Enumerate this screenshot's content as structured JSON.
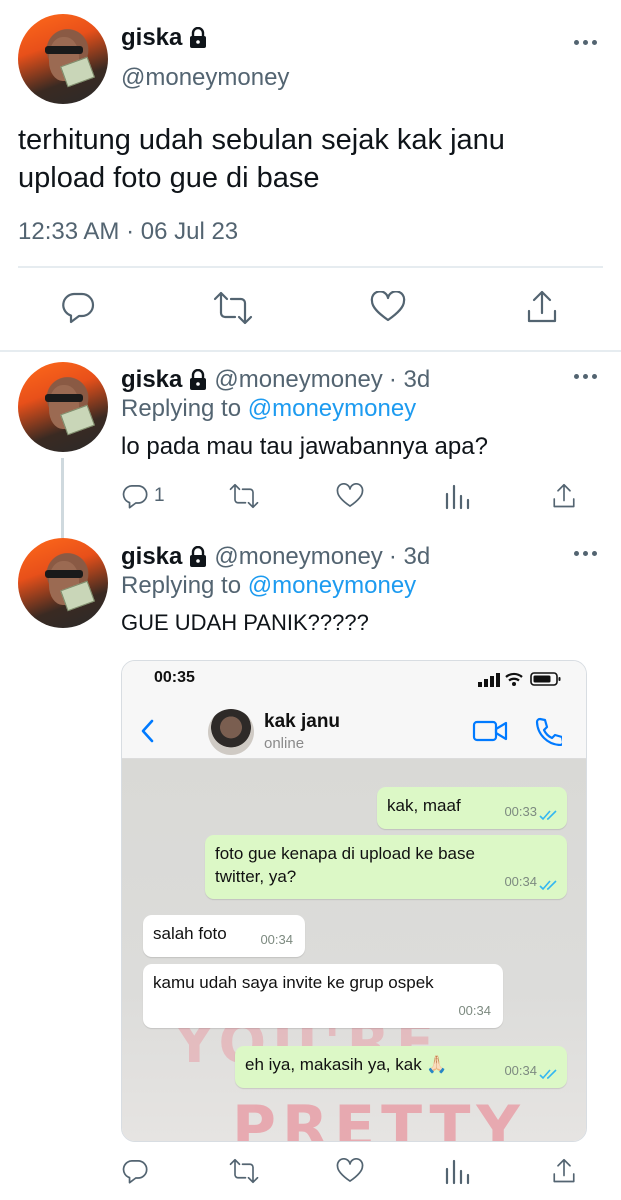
{
  "main_tweet": {
    "name": "giska",
    "handle": "@moneymoney",
    "text_line1": "terhitung udah sebulan sejak kak janu",
    "text_line2": "upload foto gue di base",
    "timestamp": "12:33 AM · 06 Jul 23"
  },
  "reply1": {
    "name": "giska",
    "handle": "@moneymoney",
    "age": "· 3d",
    "replying_prefix": "Replying to",
    "replying_to": "@moneymoney",
    "text": "lo pada mau tau jawabannya apa?",
    "reply_count": "1"
  },
  "reply2": {
    "name": "giska",
    "handle": "@moneymoney",
    "age": "· 3d",
    "replying_prefix": "Replying to",
    "replying_to": "@moneymoney",
    "text": "GUE UDAH PANIK?????"
  },
  "screenshot": {
    "status_time": "00:35",
    "contact_name": "kak janu",
    "contact_status": "online",
    "wall_text_1": "YOU'RE",
    "wall_text_2": "PRETTY",
    "messages": [
      {
        "dir": "out",
        "text": "kak, maaf",
        "time": "00:33"
      },
      {
        "dir": "out",
        "text": "foto gue kenapa di upload ke base twitter, ya?",
        "time": "00:34"
      },
      {
        "dir": "in",
        "text": "salah foto",
        "time": "00:34"
      },
      {
        "dir": "in",
        "text": "kamu udah saya invite ke grup ospek",
        "time": "00:34"
      },
      {
        "dir": "out",
        "text": "eh iya, makasih ya, kak 🙏🏻",
        "time": "00:34"
      }
    ]
  },
  "colors": {
    "accent_blue": "#1d9bf0",
    "grey_text": "#536471",
    "bubble_out": "#dcf8c6",
    "whatsapp_blue": "#007aff"
  },
  "icons": [
    "lock-icon",
    "more-icon",
    "reply-icon",
    "retweet-icon",
    "like-icon",
    "share-icon",
    "analytics-icon",
    "back-icon",
    "video-call-icon",
    "phone-icon"
  ]
}
